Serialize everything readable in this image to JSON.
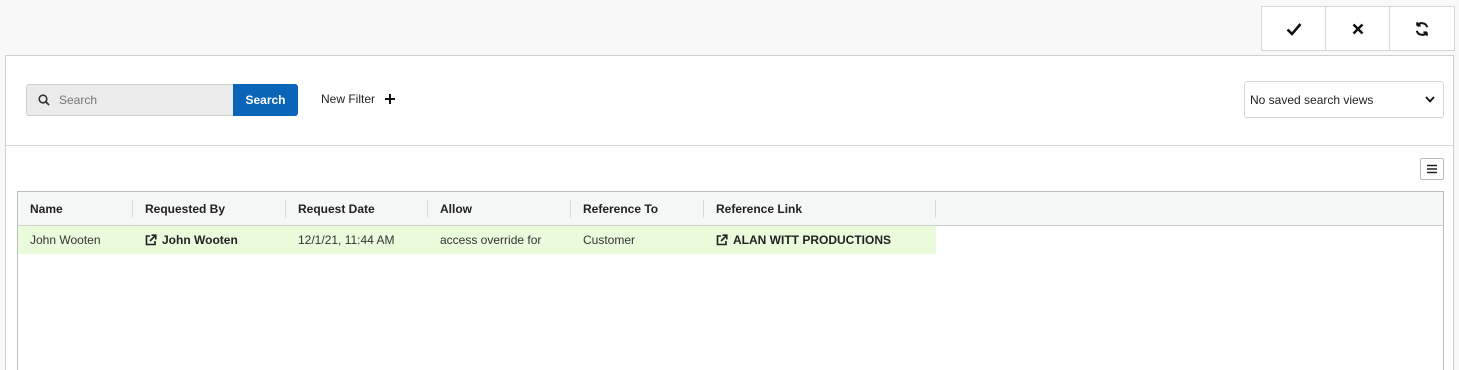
{
  "toolbar": {
    "confirm_icon": "checkmark-icon",
    "cancel_icon": "close-icon",
    "refresh_icon": "refresh-icon"
  },
  "search": {
    "placeholder": "Search",
    "value": "",
    "button_label": "Search"
  },
  "filter": {
    "new_filter_label": "New Filter"
  },
  "saved_views": {
    "selected": "No saved search views"
  },
  "grid": {
    "columns": [
      "Name",
      "Requested By",
      "Request Date",
      "Allow",
      "Reference To",
      "Reference Link"
    ],
    "rows": [
      {
        "name": "John Wooten",
        "requested_by": "John Wooten",
        "request_date": "12/1/21, 11:44 AM",
        "allow": "access override for",
        "reference_to": "Customer",
        "reference_link": "ALAN WITT PRODUCTIONS"
      }
    ]
  },
  "colors": {
    "primary": "#0a65b9",
    "row_highlight": "#eafbdc",
    "header_bg": "#f5f6f6"
  }
}
